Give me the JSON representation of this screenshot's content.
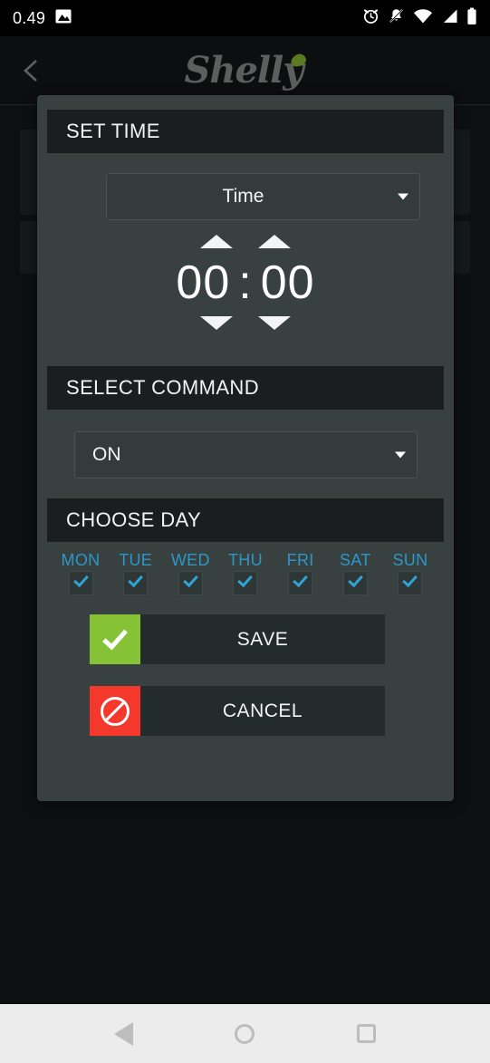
{
  "status_bar": {
    "clock": "0.49",
    "left_icons": [
      {
        "name": "image-icon"
      }
    ],
    "right_icons": [
      {
        "name": "alarm-clock-icon"
      },
      {
        "name": "bell-muted-icon"
      },
      {
        "name": "wifi-icon"
      },
      {
        "name": "cellular-signal-icon"
      },
      {
        "name": "battery-icon"
      }
    ]
  },
  "app_header": {
    "back_icon": "chevron-left-icon",
    "logo_text": "Shelly",
    "logo_leaf_color": "#5a7a22"
  },
  "dialog": {
    "set_time": {
      "header": "SET TIME",
      "type_select": {
        "value": "Time",
        "caret": "chevron-down-icon"
      },
      "spinner": {
        "hours": "00",
        "separator": ":",
        "minutes": "00",
        "hours_up_icon": "triangle-up-icon",
        "minutes_up_icon": "triangle-up-icon",
        "hours_down_icon": "triangle-down-icon",
        "minutes_down_icon": "triangle-down-icon"
      }
    },
    "select_command": {
      "header": "SELECT COMMAND",
      "command_select": {
        "value": "ON",
        "caret": "chevron-down-icon"
      }
    },
    "choose_day": {
      "header": "CHOOSE DAY",
      "days": [
        {
          "label": "MON",
          "checked": true
        },
        {
          "label": "TUE",
          "checked": true
        },
        {
          "label": "WED",
          "checked": true
        },
        {
          "label": "THU",
          "checked": true
        },
        {
          "label": "FRI",
          "checked": true
        },
        {
          "label": "SAT",
          "checked": true
        },
        {
          "label": "SUN",
          "checked": true
        }
      ]
    },
    "actions": {
      "save_label": "SAVE",
      "save_icon": "check-icon",
      "save_color": "#86c235",
      "cancel_label": "CANCEL",
      "cancel_icon": "no-entry-icon",
      "cancel_color": "#f4382c"
    }
  },
  "nav_bar": {
    "back_icon": "nav-back-triangle-icon",
    "home_icon": "nav-home-circle-icon",
    "recents_icon": "nav-recents-square-icon"
  },
  "colors": {
    "dialog_bg": "#38413f",
    "section_header_bg": "#1a1e20",
    "day_label": "#2b97c9",
    "check_blue": "#2fa3d6",
    "page_bg": "#0d1011"
  }
}
